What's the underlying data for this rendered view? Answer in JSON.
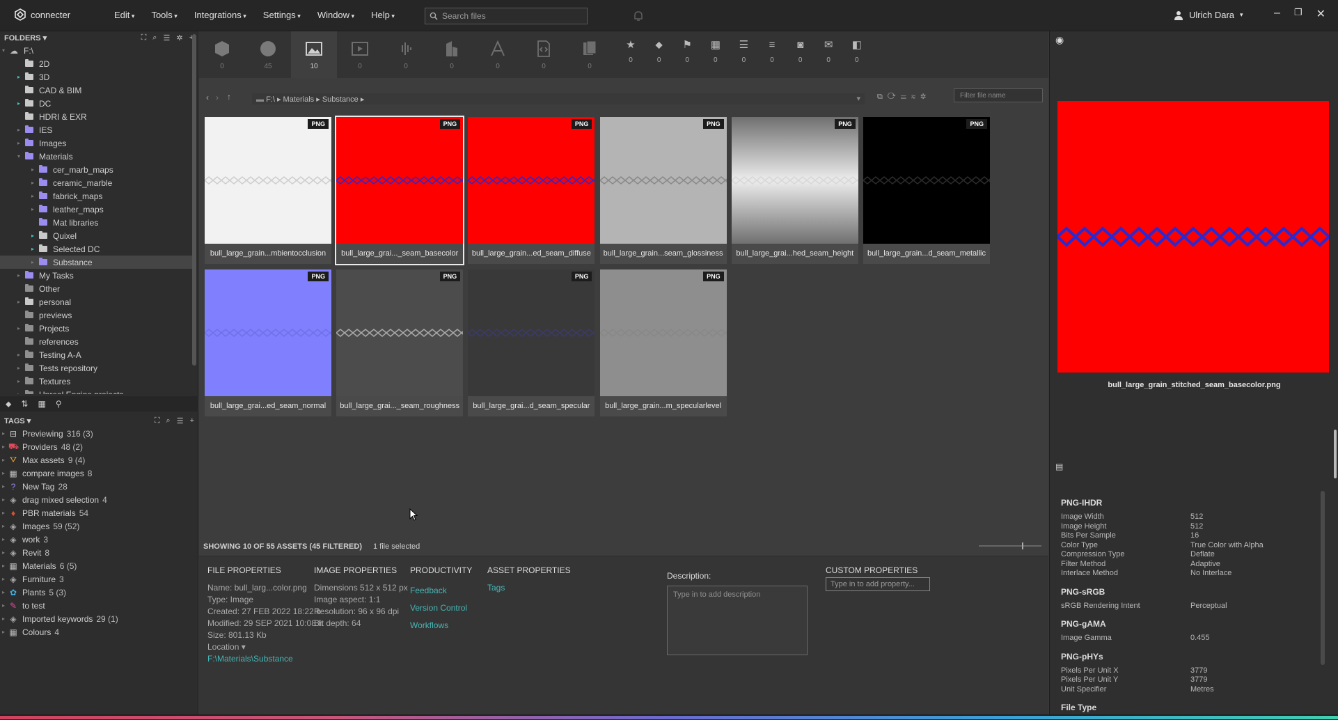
{
  "app": {
    "name": "connecter"
  },
  "menu": [
    "Edit",
    "Tools",
    "Integrations",
    "Settings",
    "Window",
    "Help"
  ],
  "search": {
    "placeholder": "Search files"
  },
  "user": {
    "name": "Ulrich Dara"
  },
  "folders": {
    "header": "FOLDERS",
    "root": "F:\\",
    "items": [
      {
        "label": "2D",
        "indent": 1,
        "style": "white",
        "arrow": "none"
      },
      {
        "label": "3D",
        "indent": 1,
        "style": "white",
        "arrow": "teal"
      },
      {
        "label": "CAD & BIM",
        "indent": 1,
        "style": "white",
        "arrow": "none"
      },
      {
        "label": "DC",
        "indent": 1,
        "style": "white",
        "arrow": "teal"
      },
      {
        "label": "HDRI & EXR",
        "indent": 1,
        "style": "white",
        "arrow": "none"
      },
      {
        "label": "IES",
        "indent": 1,
        "style": "purple",
        "arrow": "grey"
      },
      {
        "label": "Images",
        "indent": 1,
        "style": "purple",
        "arrow": "grey"
      },
      {
        "label": "Materials",
        "indent": 1,
        "style": "purple",
        "arrow": "open"
      },
      {
        "label": "cer_marb_maps",
        "indent": 2,
        "style": "purple",
        "arrow": "grey"
      },
      {
        "label": "ceramic_marble",
        "indent": 2,
        "style": "purple",
        "arrow": "grey"
      },
      {
        "label": "fabrick_maps",
        "indent": 2,
        "style": "purple",
        "arrow": "grey"
      },
      {
        "label": "leather_maps",
        "indent": 2,
        "style": "purple",
        "arrow": "grey"
      },
      {
        "label": "Mat libraries",
        "indent": 2,
        "style": "purple",
        "arrow": "none"
      },
      {
        "label": "Quixel",
        "indent": 2,
        "style": "white",
        "arrow": "teal"
      },
      {
        "label": "Selected DC",
        "indent": 2,
        "style": "white",
        "arrow": "teal"
      },
      {
        "label": "Substance",
        "indent": 2,
        "style": "purple",
        "arrow": "grey",
        "selected": true
      },
      {
        "label": "My Tasks",
        "indent": 1,
        "style": "purple",
        "arrow": "grey"
      },
      {
        "label": "Other",
        "indent": 1,
        "style": "plain",
        "arrow": "none"
      },
      {
        "label": "personal",
        "indent": 1,
        "style": "white",
        "arrow": "grey"
      },
      {
        "label": "previews",
        "indent": 1,
        "style": "plain",
        "arrow": "none"
      },
      {
        "label": "Projects",
        "indent": 1,
        "style": "plain",
        "arrow": "grey"
      },
      {
        "label": "references",
        "indent": 1,
        "style": "plain",
        "arrow": "none"
      },
      {
        "label": "Testing A-A",
        "indent": 1,
        "style": "plain",
        "arrow": "grey"
      },
      {
        "label": "Tests repository",
        "indent": 1,
        "style": "plain",
        "arrow": "grey"
      },
      {
        "label": "Textures",
        "indent": 1,
        "style": "plain",
        "arrow": "grey"
      },
      {
        "label": "Unreal Engine projects",
        "indent": 1,
        "style": "plain",
        "arrow": "grey"
      }
    ]
  },
  "tags": {
    "header": "TAGS",
    "items": [
      {
        "label": "Previewing",
        "count": "316 (3)",
        "icon": "preview-icon",
        "glyph": "⊟",
        "color": "#cfcfcf"
      },
      {
        "label": "Providers",
        "count": "48 (2)",
        "icon": "cart-icon",
        "glyph": "⛟",
        "color": "#e04a5a"
      },
      {
        "label": "Max assets",
        "count": "9 (4)",
        "icon": "max-icon",
        "glyph": "⛛",
        "color": "#e8a030"
      },
      {
        "label": "compare images",
        "count": "8",
        "icon": "grid-icon",
        "glyph": "▦",
        "color": "#bbbbbb"
      },
      {
        "label": "New Tag",
        "count": "28",
        "icon": "question-icon",
        "glyph": "?",
        "color": "#9b8cf0"
      },
      {
        "label": "drag mixed selection",
        "count": "4",
        "icon": "tag-icon",
        "glyph": "◈",
        "color": "#aaaaaa"
      },
      {
        "label": "PBR materials",
        "count": "54",
        "icon": "pbr-icon",
        "glyph": "♦",
        "color": "#e05030"
      },
      {
        "label": "Images",
        "count": "59 (52)",
        "icon": "tag-icon",
        "glyph": "◈",
        "color": "#aaaaaa"
      },
      {
        "label": "work",
        "count": "3",
        "icon": "tag-icon",
        "glyph": "◈",
        "color": "#aaaaaa"
      },
      {
        "label": "Revit",
        "count": "8",
        "icon": "tag-icon",
        "glyph": "◈",
        "color": "#aaaaaa"
      },
      {
        "label": "Materials",
        "count": "6 (5)",
        "icon": "grid-icon",
        "glyph": "▦",
        "color": "#bbbbbb"
      },
      {
        "label": "Furniture",
        "count": "3",
        "icon": "tag-icon",
        "glyph": "◈",
        "color": "#aaaaaa"
      },
      {
        "label": "Plants",
        "count": "5 (3)",
        "icon": "plant-icon",
        "glyph": "✿",
        "color": "#3fb0e0"
      },
      {
        "label": "to test",
        "count": "",
        "icon": "wrench-icon",
        "glyph": "✎",
        "color": "#e04a9a"
      },
      {
        "label": "Imported keywords",
        "count": "29 (1)",
        "icon": "tag-icon",
        "glyph": "◈",
        "color": "#aaaaaa"
      },
      {
        "label": "Colours",
        "count": "4",
        "icon": "grid-icon",
        "glyph": "▦",
        "color": "#bbbbbb"
      }
    ]
  },
  "asset_types": [
    {
      "name": "models",
      "count": "0"
    },
    {
      "name": "materials",
      "count": "45"
    },
    {
      "name": "images",
      "count": "10"
    },
    {
      "name": "videos",
      "count": "0"
    },
    {
      "name": "audio",
      "count": "0"
    },
    {
      "name": "buildings",
      "count": "0"
    },
    {
      "name": "fonts",
      "count": "0"
    },
    {
      "name": "scripts",
      "count": "0"
    },
    {
      "name": "documents",
      "count": "0"
    }
  ],
  "filters": [
    {
      "glyph": "★",
      "count": "0"
    },
    {
      "glyph": "⬥",
      "count": "0"
    },
    {
      "glyph": "⚑",
      "count": "0"
    },
    {
      "glyph": "▦",
      "count": "0"
    },
    {
      "glyph": "☰",
      "count": "0"
    },
    {
      "glyph": "≡",
      "count": "0"
    },
    {
      "glyph": "◙",
      "count": "0"
    },
    {
      "glyph": "✉",
      "count": "0"
    },
    {
      "glyph": "◧",
      "count": "0"
    }
  ],
  "breadcrumb": [
    "F:\\",
    "Materials",
    "Substance"
  ],
  "filter_placeholder": "Filter file name",
  "assets": [
    {
      "label": "bull_large_grain...mbientocclusion",
      "badge": "PNG",
      "bg": "#f2f2f2",
      "stitch": "#cfcfcf"
    },
    {
      "label": "bull_large_grai..._seam_basecolor",
      "badge": "PNG",
      "bg": "#ff0000",
      "stitch": "#2a2ad0",
      "selected": true
    },
    {
      "label": "bull_large_grain...ed_seam_diffuse",
      "badge": "PNG",
      "bg": "#ff0000",
      "stitch": "#2a2ad0"
    },
    {
      "label": "bull_large_grain...seam_glossiness",
      "badge": "PNG",
      "bg": "#b4b4b4",
      "stitch": "#8a8a8a"
    },
    {
      "label": "bull_large_grai...hed_seam_height",
      "badge": "PNG",
      "bg": "gradient",
      "stitch": "#d8d8d8"
    },
    {
      "label": "bull_large_grain...d_seam_metallic",
      "badge": "PNG",
      "bg": "#000000",
      "stitch": "#2a2a2a"
    },
    {
      "label": "bull_large_grai...ed_seam_normal",
      "badge": "PNG",
      "bg": "#8080ff",
      "stitch": "#7070e8"
    },
    {
      "label": "bull_large_grai..._seam_roughness",
      "badge": "PNG",
      "bg": "#4c4c4c",
      "stitch": "#a8a8a8"
    },
    {
      "label": "bull_large_grai...d_seam_specular",
      "badge": "PNG",
      "bg": "#393939",
      "stitch": "#3a3a6a"
    },
    {
      "label": "bull_large_grain...m_specularlevel",
      "badge": "PNG",
      "bg": "#8e8e8e",
      "stitch": "#888888"
    }
  ],
  "status": {
    "showing": "SHOWING 10 OF 55 ASSETS (45 FILTERED)",
    "selected": "1 file selected"
  },
  "file_properties": {
    "title": "FILE PROPERTIES",
    "name": "Name: bull_larg...color.png",
    "type": "Type: Image",
    "created": "Created: 27 FEB 2022 18:22 h",
    "modified": "Modified: 29 SEP 2021 10:08 h",
    "size": "Size: 801.13 Kb",
    "location_label": "Location",
    "location": "F:\\Materials\\Substance"
  },
  "image_properties": {
    "title": "IMAGE PROPERTIES",
    "dimensions": "Dimensions 512 x 512 px",
    "aspect": "Image aspect: 1:1",
    "resolution": "Resolution: 96 x 96 dpi",
    "bitdepth": "Bit depth: 64"
  },
  "productivity": {
    "title": "PRODUCTIVITY",
    "links": [
      "Feedback",
      "Version Control",
      "Workflows"
    ]
  },
  "asset_properties": {
    "title": "ASSET PROPERTIES",
    "tags": "Tags"
  },
  "description": {
    "label": "Description:",
    "placeholder": "Type in to add description"
  },
  "custom_properties": {
    "title": "CUSTOM PROPERTIES",
    "placeholder": "Type in to add property..."
  },
  "preview": {
    "filename": "bull_large_grain_stitched_seam_basecolor.png"
  },
  "metadata": [
    {
      "section": "PNG-IHDR",
      "rows": [
        [
          "Image Width",
          "512"
        ],
        [
          "Image Height",
          "512"
        ],
        [
          "Bits Per Sample",
          "16"
        ],
        [
          "Color Type",
          "True Color with Alpha"
        ],
        [
          "Compression Type",
          "Deflate"
        ],
        [
          "Filter Method",
          "Adaptive"
        ],
        [
          "Interlace Method",
          "No Interlace"
        ]
      ]
    },
    {
      "section": "PNG-sRGB",
      "rows": [
        [
          "sRGB Rendering Intent",
          "Perceptual"
        ]
      ]
    },
    {
      "section": "PNG-gAMA",
      "rows": [
        [
          "Image Gamma",
          "0.455"
        ]
      ]
    },
    {
      "section": "PNG-pHYs",
      "rows": [
        [
          "Pixels Per Unit X",
          "3779"
        ],
        [
          "Pixels Per Unit Y",
          "3779"
        ],
        [
          "Unit Specifier",
          "Metres"
        ]
      ]
    },
    {
      "section": "File Type",
      "rows": []
    }
  ]
}
